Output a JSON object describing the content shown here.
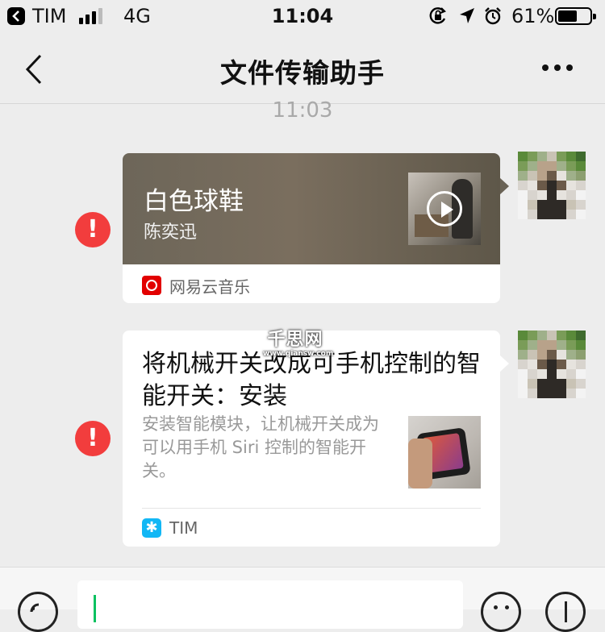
{
  "status_bar": {
    "back_app": "TIM",
    "network": "4G",
    "time": "11:04",
    "battery_percent": "61%",
    "battery_level": 0.61
  },
  "nav": {
    "title": "文件传输助手",
    "back_icon": "chevron-left-icon",
    "more_icon": "more-dots-icon"
  },
  "messages": {
    "timestamp": "11:03",
    "music_card": {
      "title": "白色球鞋",
      "artist": "陈奕迅",
      "source": "网易云音乐",
      "error_glyph": "!",
      "accent_color": "#e20000"
    },
    "article_card": {
      "title": "将机械开关改成可手机控制的智能开关：安装",
      "description": "安装智能模块，让机械开关成为可以用手机 Siri 控制的智能开关。",
      "source": "TIM",
      "error_glyph": "!",
      "accent_color": "#12b7f5"
    }
  },
  "watermark": {
    "text": "千思网",
    "url": "www.qiansw.com"
  },
  "input_bar": {
    "voice_icon": "voice-icon",
    "emoji_icon": "emoji-icon",
    "plus_icon": "plus-icon"
  },
  "colors": {
    "error_red": "#f23d3d",
    "caret_green": "#07c160"
  }
}
